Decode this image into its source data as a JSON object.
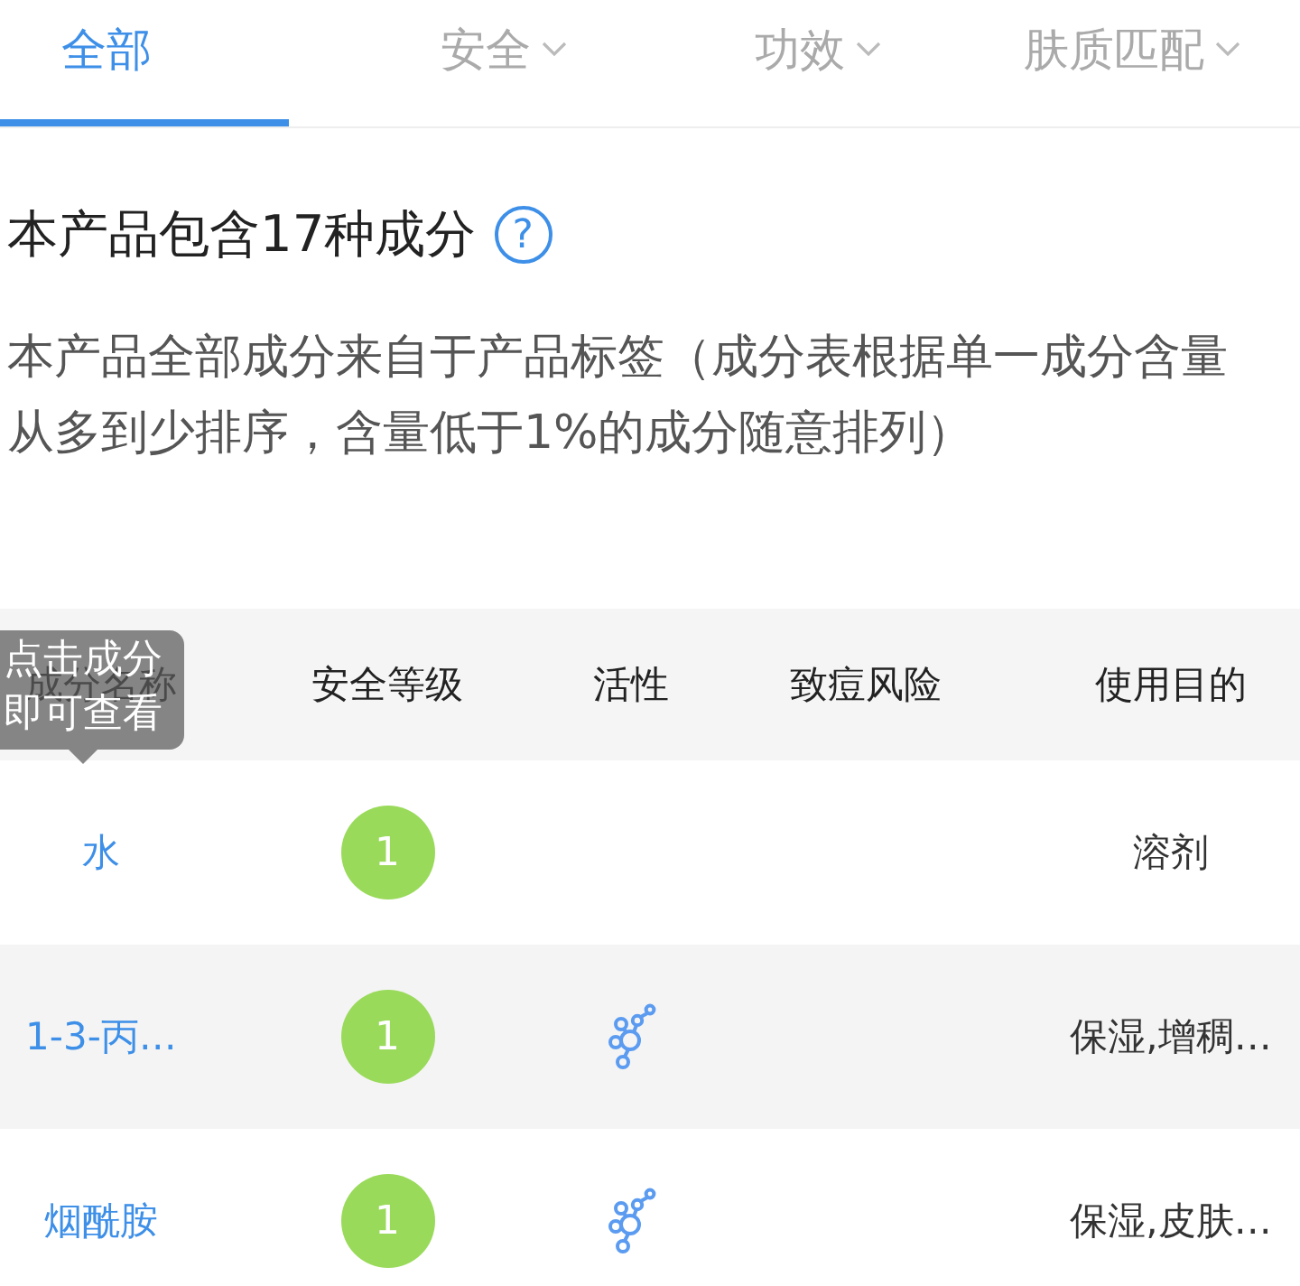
{
  "tabs": [
    {
      "label": "全部",
      "selected": true,
      "dropdown": false
    },
    {
      "label": "安全",
      "selected": false,
      "dropdown": true
    },
    {
      "label": "功效",
      "selected": false,
      "dropdown": true
    },
    {
      "label": "肤质匹配",
      "selected": false,
      "dropdown": true
    }
  ],
  "heading": "本产品包含17种成分",
  "help_button": "?",
  "description": "本产品全部成分来自于产品标签（成分表根据单一成分含量从多到少排序，含量低于1%的成分随意排列）",
  "table": {
    "columns": [
      "成分名称",
      "安全等级",
      "活性",
      "致痘风险",
      "使用目的"
    ],
    "tooltip": "点击成分即可查看",
    "rows": [
      {
        "name": "水",
        "safety": "1",
        "active": false,
        "purpose": "溶剂"
      },
      {
        "name": "1-3-丙…",
        "safety": "1",
        "active": true,
        "purpose": "保湿,增稠…"
      },
      {
        "name": "烟酰胺",
        "safety": "1",
        "active": true,
        "purpose": "保湿,皮肤…"
      }
    ]
  }
}
